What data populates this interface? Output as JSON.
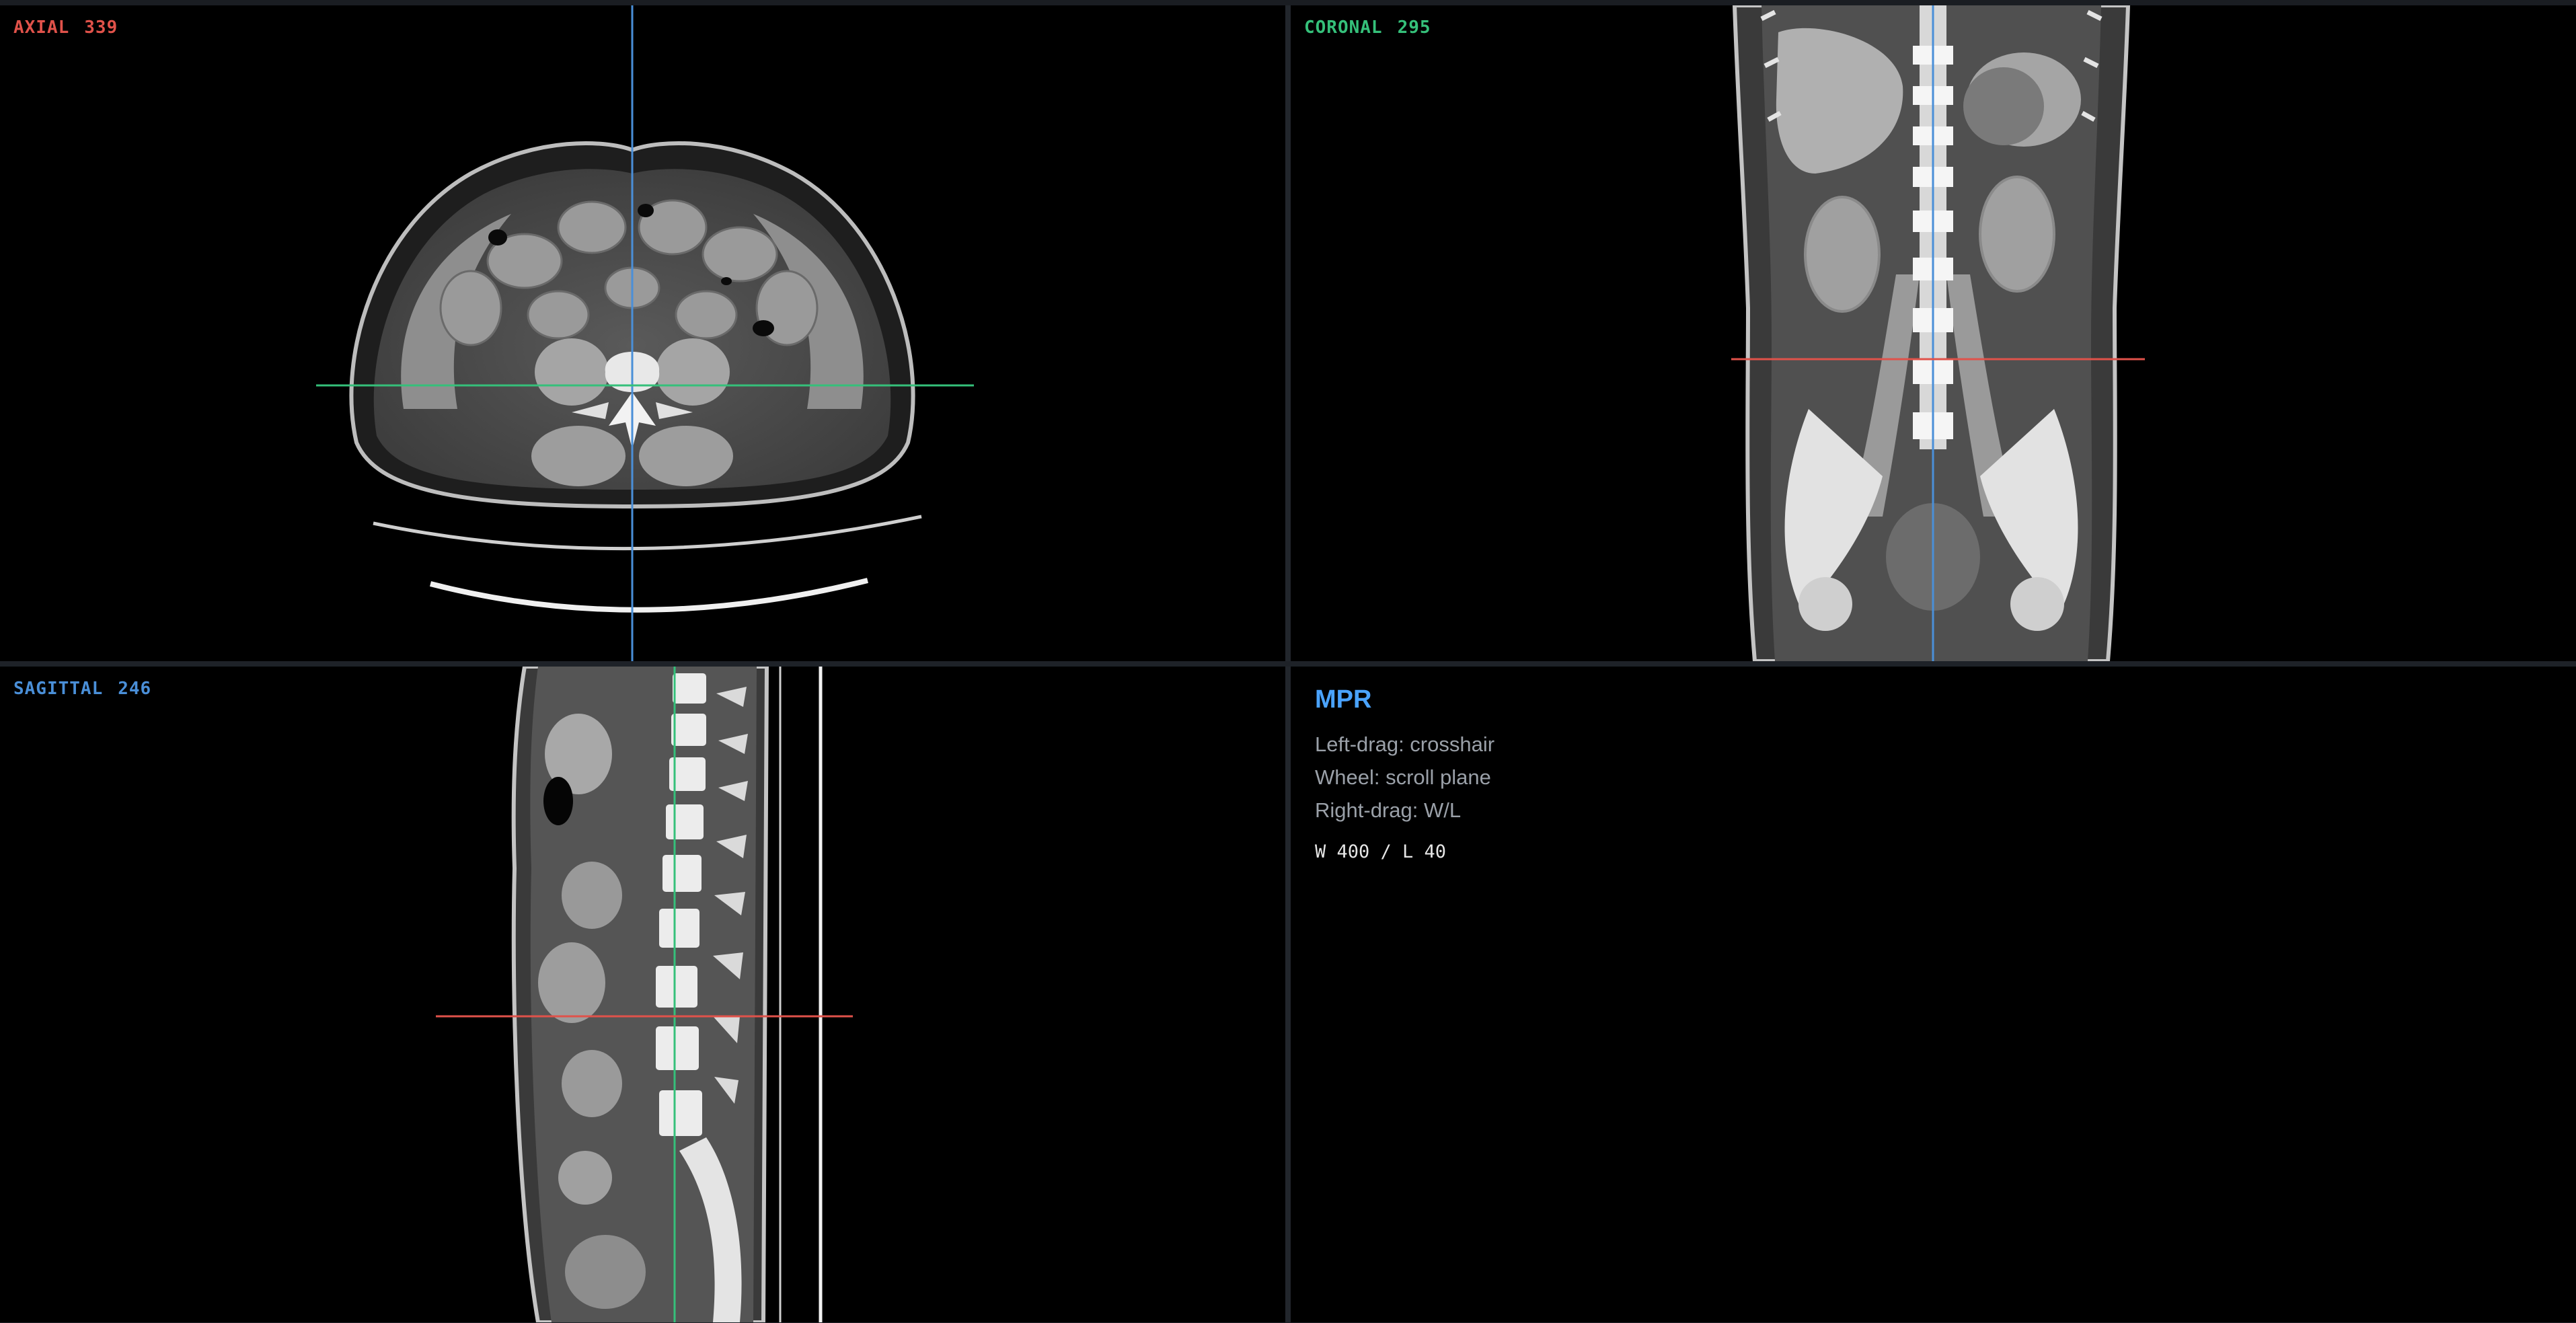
{
  "viewports": {
    "axial": {
      "name": "AXIAL",
      "slice": "339",
      "color": "#e0524a"
    },
    "coronal": {
      "name": "CORONAL",
      "slice": "295",
      "color": "#35c07a"
    },
    "sagittal": {
      "name": "SAGITTAL",
      "slice": "246",
      "color": "#4a8fd8"
    }
  },
  "crosshair_colors": {
    "axial": "#e0524a",
    "coronal": "#35c07a",
    "sagittal": "#4a8fd8"
  },
  "info": {
    "title": "MPR",
    "help": [
      "Left-drag: crosshair",
      "Wheel: scroll plane",
      "Right-drag: W/L"
    ],
    "window_level": "W 400 / L 40"
  },
  "colors": {
    "accent": "#4aa3ff",
    "background": "#000000"
  }
}
